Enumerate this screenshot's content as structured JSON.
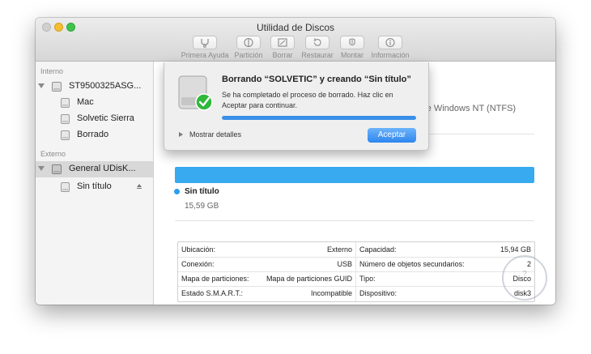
{
  "window": {
    "title": "Utilidad de Discos"
  },
  "toolbar": {
    "buttons": [
      {
        "label": "Primera Ayuda",
        "icon": "stethoscope-icon"
      },
      {
        "label": "Partición",
        "icon": "partition-icon"
      },
      {
        "label": "Borrar",
        "icon": "erase-icon"
      },
      {
        "label": "Restaurar",
        "icon": "restore-icon"
      },
      {
        "label": "Montar",
        "icon": "mount-icon"
      },
      {
        "label": "Información",
        "icon": "info-icon"
      }
    ]
  },
  "sidebar": {
    "internal_header": "Interno",
    "external_header": "Externo",
    "internal": [
      {
        "label": "ST9500325ASG..."
      },
      {
        "label": "Mac"
      },
      {
        "label": "Solvetic Sierra"
      },
      {
        "label": "Borrado"
      }
    ],
    "external": [
      {
        "label": "General UDisK..."
      },
      {
        "label": "Sin título"
      }
    ]
  },
  "main": {
    "format_text": "s de Windows NT (NTFS)",
    "volume": {
      "name": "Sin título",
      "size": "15,59 GB"
    },
    "info": {
      "left": [
        {
          "key": "Ubicación:",
          "value": "Externo"
        },
        {
          "key": "Conexión:",
          "value": "USB"
        },
        {
          "key": "Mapa de particiones:",
          "value": "Mapa de particiones GUID"
        },
        {
          "key": "Estado S.M.A.R.T.:",
          "value": "Incompatible"
        }
      ],
      "right": [
        {
          "key": "Capacidad:",
          "value": "15,94 GB"
        },
        {
          "key": "Número de objetos secundarios:",
          "value": "2"
        },
        {
          "key": "Tipo:",
          "value": "Disco"
        },
        {
          "key": "Dispositivo:",
          "value": "disk3"
        }
      ]
    }
  },
  "dialog": {
    "title": "Borrando “SOLVETIC” y creando “Sin título”",
    "message": "Se ha completado el proceso de borrado. Haz clic en Aceptar para continuar.",
    "progress": 1.0,
    "details_label": "Mostrar detalles",
    "ok_label": "Aceptar"
  },
  "watermark": {
    "text": "?"
  },
  "colors": {
    "accent": "#37aaf0",
    "button": "#2d86ee",
    "success": "#2fb83a"
  }
}
